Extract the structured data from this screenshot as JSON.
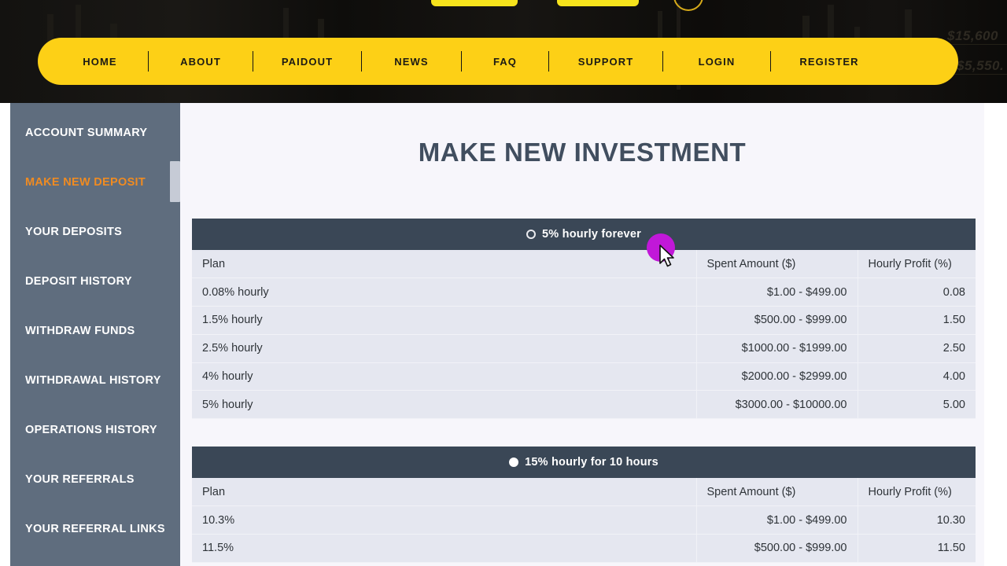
{
  "header": {
    "nav_items": [
      {
        "label": "HOME"
      },
      {
        "label": "ABOUT"
      },
      {
        "label": "PAIDOUT"
      },
      {
        "label": "NEWS"
      },
      {
        "label": "FAQ"
      },
      {
        "label": "SUPPORT"
      },
      {
        "label": "LOGIN"
      },
      {
        "label": "REGISTER"
      }
    ],
    "background_tickers": [
      {
        "value": "$15,600"
      },
      {
        "value": "$5,550."
      }
    ]
  },
  "sidebar": {
    "items": [
      {
        "label": "ACCOUNT SUMMARY",
        "active": false
      },
      {
        "label": "MAKE NEW DEPOSIT",
        "active": true
      },
      {
        "label": "YOUR DEPOSITS",
        "active": false
      },
      {
        "label": "DEPOSIT HISTORY",
        "active": false
      },
      {
        "label": "WITHDRAW FUNDS",
        "active": false
      },
      {
        "label": "WITHDRAWAL HISTORY",
        "active": false
      },
      {
        "label": "OPERATIONS HISTORY",
        "active": false
      },
      {
        "label": "YOUR REFERRALS",
        "active": false
      },
      {
        "label": "YOUR REFERRAL LINKS",
        "active": false
      }
    ]
  },
  "main": {
    "page_title": "MAKE NEW INVESTMENT",
    "columns": [
      "Plan",
      "Spent Amount ($)",
      "Hourly Profit (%)"
    ],
    "plans": [
      {
        "title": "5% hourly forever",
        "selected": false,
        "rows": [
          {
            "plan": "0.08% hourly",
            "spent": "$1.00 - $499.00",
            "profit": "0.08"
          },
          {
            "plan": "1.5% hourly",
            "spent": "$500.00 - $999.00",
            "profit": "1.50"
          },
          {
            "plan": "2.5% hourly",
            "spent": "$1000.00 - $1999.00",
            "profit": "2.50"
          },
          {
            "plan": "4% hourly",
            "spent": "$2000.00 - $2999.00",
            "profit": "4.00"
          },
          {
            "plan": "5% hourly",
            "spent": "$3000.00 - $10000.00",
            "profit": "5.00"
          }
        ]
      },
      {
        "title": "15% hourly for 10 hours",
        "selected": true,
        "rows": [
          {
            "plan": "10.3%",
            "spent": "$1.00 - $499.00",
            "profit": "10.30"
          },
          {
            "plan": "11.5%",
            "spent": "$500.00 - $999.00",
            "profit": "11.50"
          }
        ]
      }
    ]
  },
  "colors": {
    "nav_yellow": "#fdd016",
    "sidebar_slate": "#5f6d7e",
    "active_orange": "#ef8b22",
    "table_header_dark": "#3a4756",
    "table_row_bg": "#e5e7f0",
    "cursor_highlight": "#c118d8"
  }
}
